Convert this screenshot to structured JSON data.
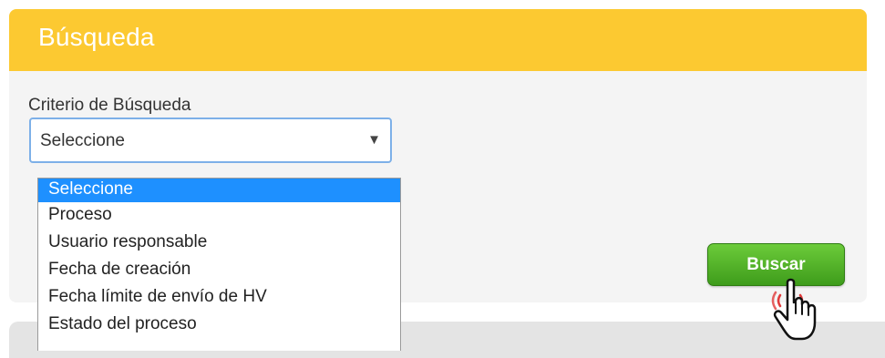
{
  "panel": {
    "title": "Búsqueda"
  },
  "search": {
    "criterion_label": "Criterio de Búsqueda",
    "selected_value": "Seleccione",
    "options": [
      "Seleccione",
      "Proceso",
      "Usuario responsable",
      "Fecha de creación",
      "Fecha límite de envío de HV",
      "Estado del proceso"
    ]
  },
  "actions": {
    "search_button_label": "Buscar"
  },
  "icons": {
    "dropdown_arrow": "chevron-down-icon",
    "cursor": "hand-pointer-icon"
  },
  "colors": {
    "header": "#fcc931",
    "button": "#4fb52a",
    "selected_option": "#1e90ff"
  }
}
